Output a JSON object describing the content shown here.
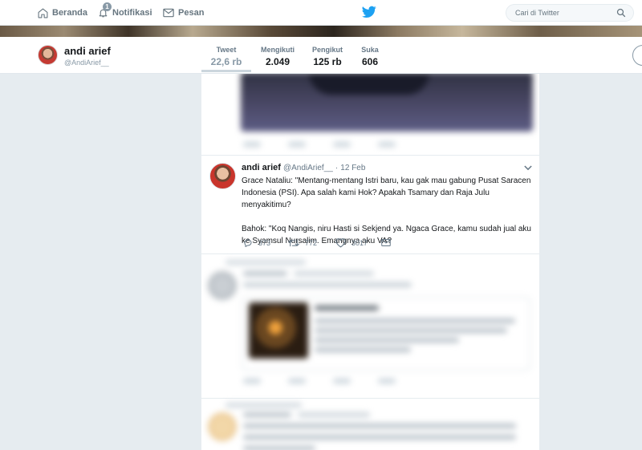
{
  "topnav": {
    "items": [
      {
        "label": "Beranda",
        "icon": "home-icon"
      },
      {
        "label": "Notifikasi",
        "icon": "bell-icon",
        "badge": "1"
      },
      {
        "label": "Pesan",
        "icon": "envelope-icon"
      }
    ],
    "logo": "twitter-bird-icon",
    "search": {
      "placeholder": "Cari di Twitter"
    }
  },
  "profile": {
    "name": "andi arief",
    "handle": "@AndiArief__",
    "stats": [
      {
        "label": "Tweet",
        "value": "22,6 rb",
        "active": true
      },
      {
        "label": "Mengikuti",
        "value": "2.049"
      },
      {
        "label": "Pengikut",
        "value": "125 rb"
      },
      {
        "label": "Suka",
        "value": "606"
      }
    ]
  },
  "tweet": {
    "name": "andi arief",
    "handle": "@AndiArief__",
    "separator": "·",
    "time": "12 Feb",
    "paragraph1": "Grace Nataliu: \"Mentang-mentang Istri baru, kau gak mau gabung Pusat Saracen Indonesia (PSI). Apa salah kami Hok? Apakah Tsamary  dan Raja Julu menyakitimu?",
    "paragraph2": "Bahok: \"Koq Nangis, niru Hasti si Sekjend ya. Ngaca Grace, kamu sudah jual aku ke Syamsul Nursalim.  Emangnya aku VA?",
    "replies": "373",
    "retweets": "772",
    "likes": "3017"
  },
  "colors": {
    "brand": "#1da1f2",
    "background": "#e6ecf0",
    "muted": "#657786"
  }
}
